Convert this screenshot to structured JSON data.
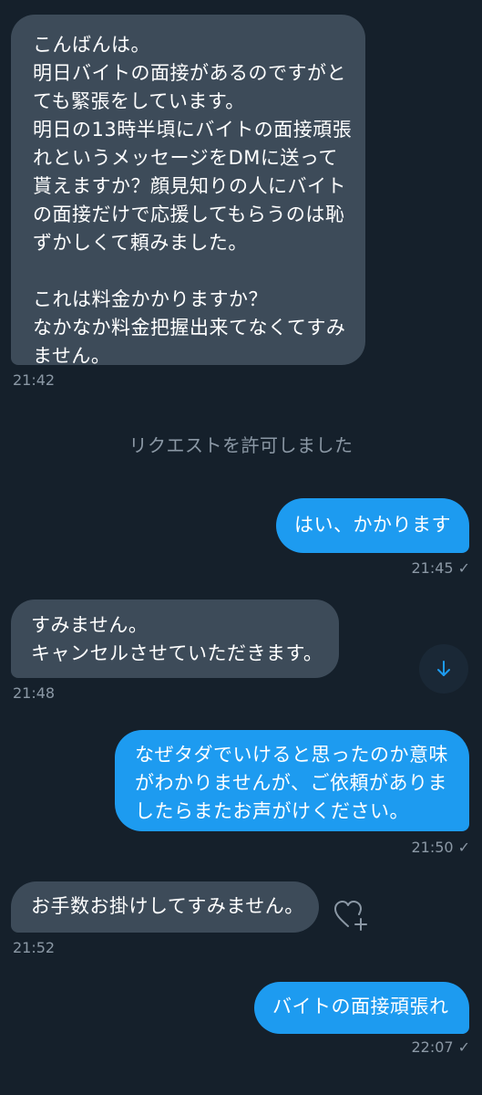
{
  "messages": [
    {
      "text": "こんばんは。\n明日バイトの面接があるのですがとても緊張をしています。\n明日の13時半頃にバイトの面接頑張れというメッセージをDMに送って貰えますか？顔見知りの人にバイトの面接だけで応援してもらうのは恥ずかしくて頼みました。\n\nこれは料金かかりますか？\nなかなか料金把握出来てなくてすみません。",
      "time": "21:42"
    },
    {
      "text": "はい、かかります",
      "time": "21:45"
    },
    {
      "text": "すみません。\nキャンセルさせていただきます。",
      "time": "21:48"
    },
    {
      "text": "なぜタダでいけると思ったのか意味がわかりませんが、ご依頼がありましたらまたお声がけください。",
      "time": "21:50"
    },
    {
      "text": "お手数お掛けしてすみません。",
      "time": "21:52"
    },
    {
      "text": "バイトの面接頑張れ",
      "time": "22:07"
    }
  ],
  "system_message": "リクエストを許可しました",
  "icons": {
    "scroll_down": "arrow-down-icon",
    "react": "heart-plus-icon",
    "read": "check-icon"
  },
  "colors": {
    "background": "#15202b",
    "received_bubble": "#3d4b59",
    "sent_bubble": "#1d9bf0",
    "meta_text": "#8b98a5"
  }
}
